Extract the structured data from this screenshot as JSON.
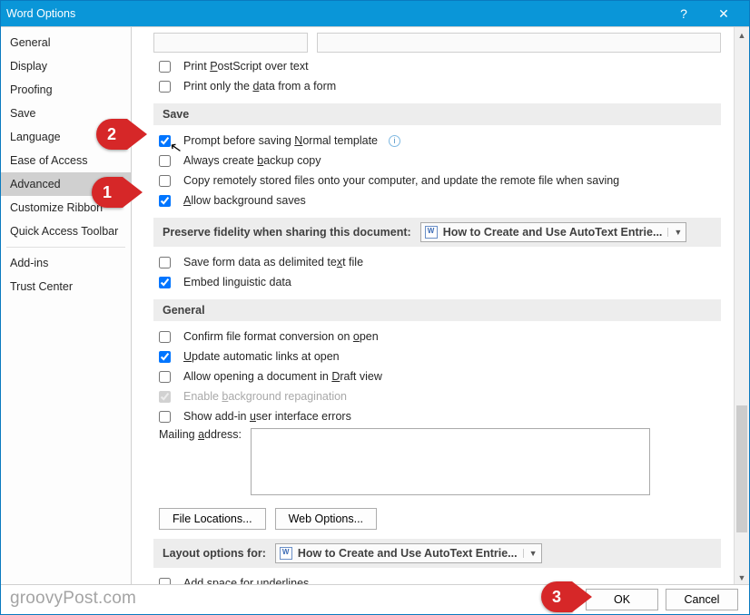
{
  "titlebar": {
    "title": "Word Options"
  },
  "sidebar": {
    "items": [
      {
        "label": "General"
      },
      {
        "label": "Display"
      },
      {
        "label": "Proofing"
      },
      {
        "label": "Save"
      },
      {
        "label": "Language"
      },
      {
        "label": "Ease of Access"
      },
      {
        "label": "Advanced",
        "selected": true
      },
      {
        "label": "Customize Ribbon"
      },
      {
        "label": "Quick Access Toolbar"
      },
      {
        "label": "Add-ins"
      },
      {
        "label": "Trust Center"
      }
    ]
  },
  "top_options": {
    "print_postscript": "Print PostScript over text",
    "print_only_data": "Print only the data from a form"
  },
  "save_section": {
    "title": "Save",
    "prompt_normal": "Prompt before saving Normal template",
    "always_backup": "Always create backup copy",
    "copy_remotely": "Copy remotely stored files onto your computer, and update the remote file when saving",
    "allow_bg_saves": "Allow background saves"
  },
  "preserve_section": {
    "title": "Preserve fidelity when sharing this document:",
    "dropdown": "How to Create and Use AutoText Entrie...",
    "save_form_data": "Save form data as delimited text file",
    "embed_linguistic": "Embed linguistic data"
  },
  "general_section": {
    "title": "General",
    "confirm_convert": "Confirm file format conversion on open",
    "update_links": "Update automatic links at open",
    "allow_draft": "Allow opening a document in Draft view",
    "enable_repag": "Enable background repagination",
    "show_addin_errors": "Show add-in user interface errors",
    "mailing_label": "Mailing address:",
    "mailing_value": "",
    "file_locations_btn": "File Locations...",
    "web_options_btn": "Web Options..."
  },
  "layout_section": {
    "title": "Layout options for:",
    "dropdown": "How to Create and Use AutoText Entrie...",
    "add_space_underlines": "Add space for underlines"
  },
  "buttons": {
    "ok": "OK",
    "cancel": "Cancel"
  },
  "callouts": {
    "c1": "1",
    "c2": "2",
    "c3": "3"
  },
  "watermark": "groovyPost.com"
}
